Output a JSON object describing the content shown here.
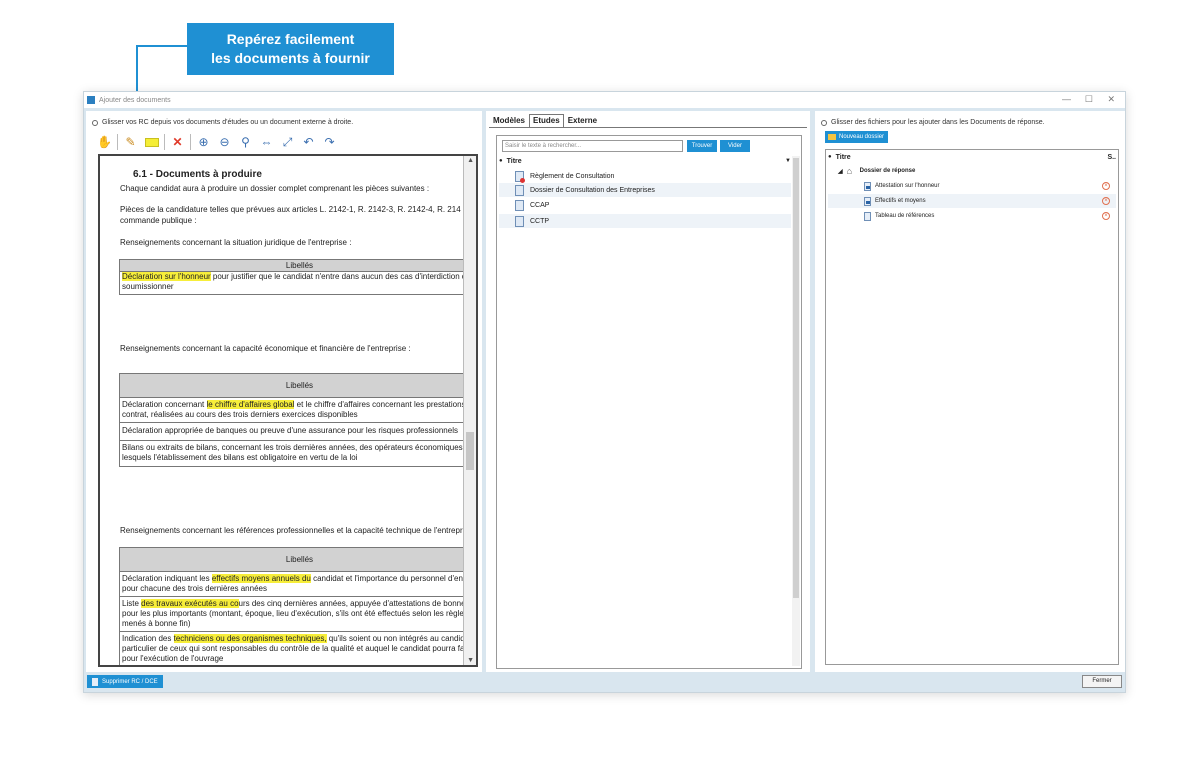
{
  "callout": {
    "line1": "Repérez facilement",
    "line2": "les documents à fournir"
  },
  "window": {
    "title": "Ajouter des documents",
    "minimize": "—",
    "maximize": "☐",
    "close": "✕"
  },
  "left": {
    "hint": "Glisser vos RC depuis vos documents d'études ou un document externe à droite.",
    "doc": {
      "title": "6.1 - Documents à produire",
      "intro": "Chaque candidat aura à produire un dossier complet comprenant les pièces suivantes :",
      "pieces_1": "Pièces de la candidature telles que prévues aux articles L. 2142-1, R. 2142-3, R. 2142-4, R. 214",
      "pieces_2": "commande publique :",
      "section1": "Renseignements concernant la situation juridique de l'entreprise :",
      "table_header": "Libellés",
      "t1_r1_hl": "Déclaration sur l'honneur",
      "t1_r1_rest": " pour justifier que le candidat n'entre dans aucun des cas d'interdiction de",
      "t1_r1_line2": "soumissionner",
      "section2": "Renseignements concernant la capacité économique et financière de l'entreprise :",
      "t2_r1_a": "Déclaration concernant ",
      "t2_r1_hl": "le chiffre d'affaires global",
      "t2_r1_b": " et le chiffre d'affaires concernant les prestations ol",
      "t2_r1_line2": "contrat, réalisées au cours des trois derniers exercices disponibles",
      "t2_r2": "Déclaration appropriée de banques ou preuve d'une assurance pour les risques professionnels",
      "t2_r3_l1": "Bilans ou extraits de bilans, concernant les trois dernières années, des opérateurs économiques po",
      "t2_r3_l2": "lesquels l'établissement des bilans est obligatoire en vertu de la loi",
      "section3": "Renseignements concernant les références professionnelles et la capacité technique de l'entreprise",
      "t3_r1_a": "Déclaration indiquant les ",
      "t3_r1_hl": "effectifs moyens annuels du",
      "t3_r1_b": " candidat et l'importance du personnel d'encad",
      "t3_r1_line2": "pour chacune des trois dernières années",
      "t3_r2_a": "Liste ",
      "t3_r2_hl": "des travaux exécutés au co",
      "t3_r2_b": "urs des cinq dernières années, appuyée d'attestations de bonne ex",
      "t3_r2_l2": "pour les plus importants (montant, époque, lieu d'exécution, s'ils ont été effectués selon les règles d",
      "t3_r2_l3": "menés à bonne fin)",
      "t3_r3_a": "Indication des ",
      "t3_r3_hl": "techniciens ou des organismes techniques,",
      "t3_r3_b": " qu'ils soient ou non intégrés au candidat,",
      "t3_r3_l2": "particulier de ceux qui sont responsables du contrôle de la qualité et auquel le candidat pourra faire",
      "t3_r3_l3": "pour l'exécution de l'ouvrage"
    }
  },
  "middle": {
    "tabs": [
      "Modèles",
      "Etudes",
      "Externe"
    ],
    "active_tab": "Etudes",
    "search_placeholder": "Saisir le texte à rechercher...",
    "btn_search": "Trouver",
    "btn_clear": "Vider",
    "column": "Titre",
    "items": [
      "Règlement de Consultation",
      "Dossier de Consultation des Entreprises",
      "CCAP",
      "CCTP"
    ]
  },
  "right": {
    "hint": "Glisser des fichiers pour les ajouter dans les Documents de réponse.",
    "btn_new_folder": "Nouveau dossier",
    "col_title": "Titre",
    "col_s": "S..",
    "root": "Dossier de réponse",
    "items": [
      "Attestation sur l'honneur",
      "Effectifs et moyens",
      "Tableau de références"
    ]
  },
  "footer": {
    "delete_btn": "Supprimer RC / DCE",
    "close_btn": "Fermer"
  },
  "colors": {
    "accent": "#1f90d3",
    "highlight": "#f7ee3a"
  }
}
